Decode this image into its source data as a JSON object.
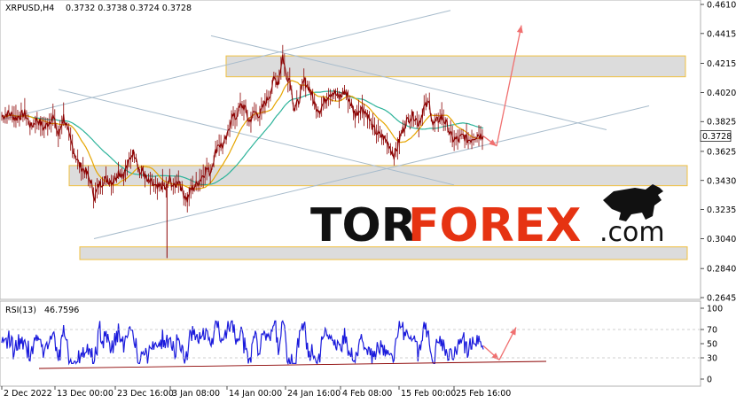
{
  "chart_data": [
    {
      "type": "candlestick",
      "title": "XRPUSD,H4",
      "ohlc_readout": "0.3732 0.3738 0.3724 0.3728",
      "current_price": "0.3728",
      "ylim": [
        0.2645,
        0.461
      ],
      "y_ticks": [
        "0.4610",
        "0.4415",
        "0.4215",
        "0.4020",
        "0.3825",
        "0.3625",
        "0.3430",
        "0.3235",
        "0.3040",
        "0.2840",
        "0.2645"
      ],
      "x_ticks": [
        "2 Dec 2022",
        "13 Dec 00:00",
        "23 Dec 16:00",
        "3 Jan 08:00",
        "14 Jan 00:00",
        "24 Jan 16:00",
        "4 Feb 08:00",
        "15 Feb 00:00",
        "25 Feb 16:00"
      ],
      "price_path": [
        [
          0,
          0.386
        ],
        [
          8,
          0.388
        ],
        [
          16,
          0.385
        ],
        [
          26,
          0.388
        ],
        [
          33,
          0.379
        ],
        [
          40,
          0.384
        ],
        [
          48,
          0.378
        ],
        [
          58,
          0.386
        ],
        [
          64,
          0.373
        ],
        [
          70,
          0.386
        ],
        [
          76,
          0.373
        ],
        [
          82,
          0.362
        ],
        [
          88,
          0.353
        ],
        [
          95,
          0.349
        ],
        [
          100,
          0.343
        ],
        [
          105,
          0.332
        ],
        [
          110,
          0.34
        ],
        [
          118,
          0.344
        ],
        [
          126,
          0.342
        ],
        [
          132,
          0.349
        ],
        [
          138,
          0.347
        ],
        [
          143,
          0.354
        ],
        [
          148,
          0.362
        ],
        [
          152,
          0.36
        ],
        [
          156,
          0.348
        ],
        [
          160,
          0.349
        ],
        [
          165,
          0.342
        ],
        [
          170,
          0.341
        ],
        [
          176,
          0.337
        ],
        [
          182,
          0.34
        ],
        [
          186,
          0.337
        ],
        [
          190,
          0.344
        ],
        [
          195,
          0.338
        ],
        [
          200,
          0.344
        ],
        [
          205,
          0.335
        ],
        [
          210,
          0.33
        ],
        [
          214,
          0.337
        ],
        [
          220,
          0.34
        ],
        [
          226,
          0.345
        ],
        [
          232,
          0.351
        ],
        [
          236,
          0.348
        ],
        [
          240,
          0.358
        ],
        [
          245,
          0.368
        ],
        [
          250,
          0.366
        ],
        [
          255,
          0.372
        ],
        [
          260,
          0.386
        ],
        [
          265,
          0.385
        ],
        [
          270,
          0.393
        ],
        [
          275,
          0.392
        ],
        [
          280,
          0.382
        ],
        [
          286,
          0.389
        ],
        [
          292,
          0.387
        ],
        [
          298,
          0.395
        ],
        [
          303,
          0.4
        ],
        [
          308,
          0.411
        ],
        [
          313,
          0.409
        ],
        [
          318,
          0.427
        ],
        [
          322,
          0.413
        ],
        [
          326,
          0.411
        ],
        [
          331,
          0.391
        ],
        [
          336,
          0.396
        ],
        [
          342,
          0.41
        ],
        [
          348,
          0.405
        ],
        [
          355,
          0.393
        ],
        [
          360,
          0.39
        ],
        [
          365,
          0.396
        ],
        [
          370,
          0.401
        ],
        [
          376,
          0.402
        ],
        [
          382,
          0.398
        ],
        [
          388,
          0.403
        ],
        [
          394,
          0.396
        ],
        [
          400,
          0.387
        ],
        [
          407,
          0.392
        ],
        [
          414,
          0.387
        ],
        [
          420,
          0.378
        ],
        [
          426,
          0.374
        ],
        [
          432,
          0.372
        ],
        [
          438,
          0.367
        ],
        [
          444,
          0.36
        ],
        [
          448,
          0.366
        ],
        [
          452,
          0.374
        ],
        [
          456,
          0.38
        ],
        [
          460,
          0.384
        ],
        [
          466,
          0.387
        ],
        [
          472,
          0.381
        ],
        [
          478,
          0.392
        ],
        [
          484,
          0.395
        ],
        [
          488,
          0.38
        ],
        [
          493,
          0.383
        ],
        [
          498,
          0.386
        ],
        [
          504,
          0.38
        ],
        [
          510,
          0.371
        ],
        [
          516,
          0.37
        ],
        [
          522,
          0.373
        ],
        [
          528,
          0.37
        ],
        [
          534,
          0.372
        ],
        [
          540,
          0.374
        ],
        [
          545,
          0.3728
        ]
      ],
      "indicator": {
        "name": "RSI(13)",
        "value": "46.7596",
        "levels": [
          30,
          70
        ],
        "ylim": [
          0,
          100
        ],
        "y_ticks": [
          "100",
          "70",
          "50",
          "30",
          "0"
        ]
      },
      "colors": {
        "price_line": "#8b0000",
        "rsi_line": "#1a1adc",
        "ma_slow": "#2db39a",
        "ma_fast": "#e6a500",
        "channel": "#a8bccc",
        "zone_border": "#f0c040",
        "zone_fill": "#dcdcdc",
        "arrow": "#f07070"
      }
    }
  ],
  "logo": {
    "tor": "TOR",
    "forex": "FOREX",
    "com": ".com"
  }
}
